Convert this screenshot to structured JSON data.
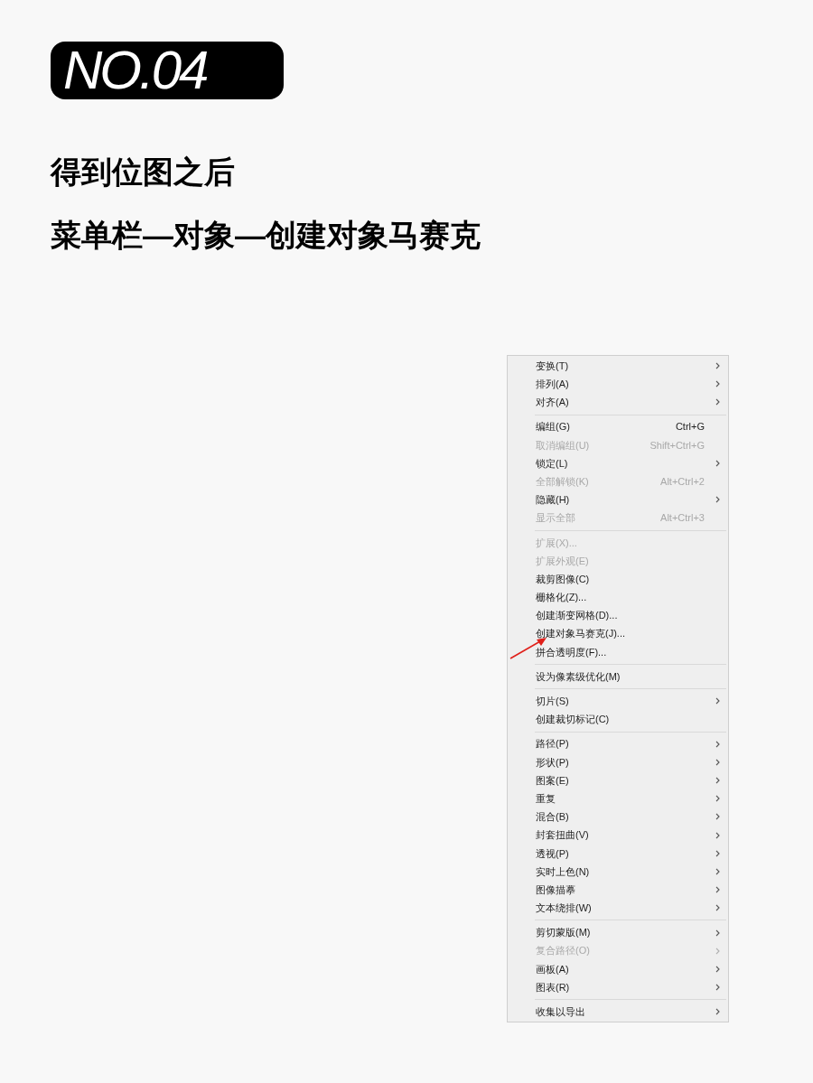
{
  "badge": "NO.04",
  "headings": [
    "得到位图之后",
    "菜单栏—对象—创建对象马赛克"
  ],
  "menu": {
    "groups": [
      [
        {
          "label": "变换(T)",
          "submenu": true,
          "disabled": false
        },
        {
          "label": "排列(A)",
          "submenu": true,
          "disabled": false
        },
        {
          "label": "对齐(A)",
          "submenu": true,
          "disabled": false
        }
      ],
      [
        {
          "label": "编组(G)",
          "shortcut": "Ctrl+G",
          "submenu": false,
          "disabled": false
        },
        {
          "label": "取消编组(U)",
          "shortcut": "Shift+Ctrl+G",
          "submenu": false,
          "disabled": true
        },
        {
          "label": "锁定(L)",
          "submenu": true,
          "disabled": false
        },
        {
          "label": "全部解锁(K)",
          "shortcut": "Alt+Ctrl+2",
          "submenu": false,
          "disabled": true
        },
        {
          "label": "隐藏(H)",
          "submenu": true,
          "disabled": false
        },
        {
          "label": "显示全部",
          "shortcut": "Alt+Ctrl+3",
          "submenu": false,
          "disabled": true
        }
      ],
      [
        {
          "label": "扩展(X)...",
          "submenu": false,
          "disabled": true
        },
        {
          "label": "扩展外观(E)",
          "submenu": false,
          "disabled": true
        },
        {
          "label": "裁剪图像(C)",
          "submenu": false,
          "disabled": false
        },
        {
          "label": "栅格化(Z)...",
          "submenu": false,
          "disabled": false
        },
        {
          "label": "创建渐变网格(D)...",
          "submenu": false,
          "disabled": false
        },
        {
          "label": "创建对象马赛克(J)...",
          "submenu": false,
          "disabled": false
        },
        {
          "label": "拼合透明度(F)...",
          "submenu": false,
          "disabled": false
        }
      ],
      [
        {
          "label": "设为像素级优化(M)",
          "submenu": false,
          "disabled": false
        }
      ],
      [
        {
          "label": "切片(S)",
          "submenu": true,
          "disabled": false
        },
        {
          "label": "创建裁切标记(C)",
          "submenu": false,
          "disabled": false
        }
      ],
      [
        {
          "label": "路径(P)",
          "submenu": true,
          "disabled": false
        },
        {
          "label": "形状(P)",
          "submenu": true,
          "disabled": false
        },
        {
          "label": "图案(E)",
          "submenu": true,
          "disabled": false
        },
        {
          "label": "重复",
          "submenu": true,
          "disabled": false
        },
        {
          "label": "混合(B)",
          "submenu": true,
          "disabled": false
        },
        {
          "label": "封套扭曲(V)",
          "submenu": true,
          "disabled": false
        },
        {
          "label": "透视(P)",
          "submenu": true,
          "disabled": false
        },
        {
          "label": "实时上色(N)",
          "submenu": true,
          "disabled": false
        },
        {
          "label": "图像描摹",
          "submenu": true,
          "disabled": false
        },
        {
          "label": "文本绕排(W)",
          "submenu": true,
          "disabled": false
        }
      ],
      [
        {
          "label": "剪切蒙版(M)",
          "submenu": true,
          "disabled": false
        },
        {
          "label": "复合路径(O)",
          "submenu": true,
          "disabled": true
        },
        {
          "label": "画板(A)",
          "submenu": true,
          "disabled": false
        },
        {
          "label": "图表(R)",
          "submenu": true,
          "disabled": false
        }
      ],
      [
        {
          "label": "收集以导出",
          "submenu": true,
          "disabled": false
        }
      ]
    ]
  }
}
